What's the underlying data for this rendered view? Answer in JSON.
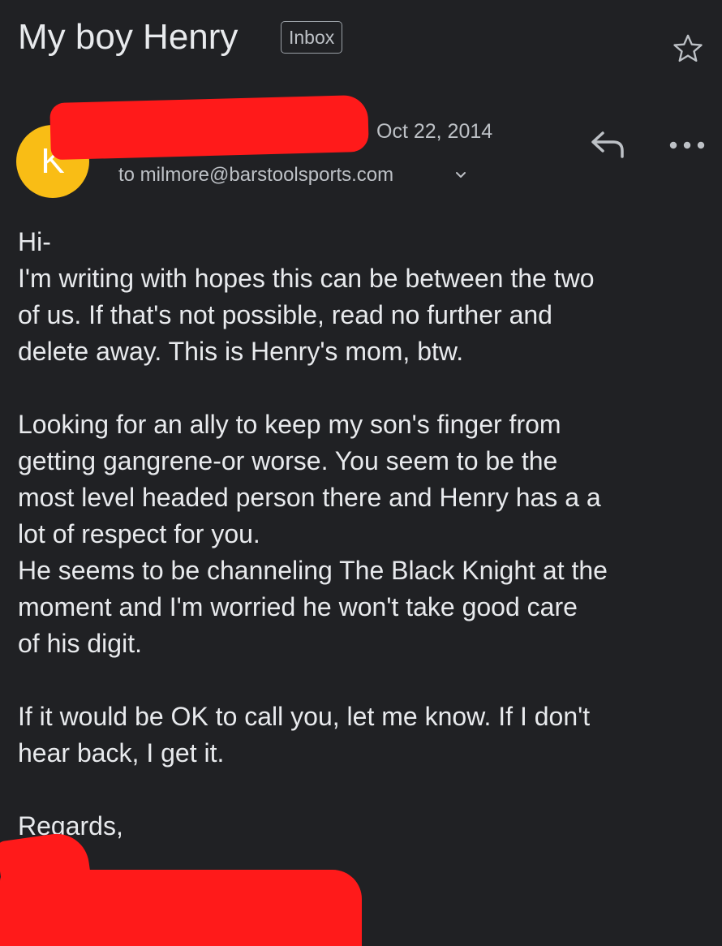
{
  "email": {
    "subject": "My boy Henry",
    "label": "Inbox",
    "sender_initial": "K",
    "date": "Oct 22, 2014",
    "recipient": "to milmore@barstoolsports.com",
    "body_lines": [
      "Hi-",
      "I'm writing with hopes this can be between the two",
      "of us. If that's not possible, read no further and",
      "delete away. This is Henry's mom, btw.",
      "",
      "Looking for an ally to keep my son's finger from",
      "getting gangrene-or worse. You seem to be the",
      "most level headed person there and Henry has a a",
      "lot of respect for you.",
      "He seems to be channeling The Black Knight at the",
      "moment and I'm worried he won't take good care",
      "of his digit.",
      "",
      "If it would be OK to call you, let me know. If I don't",
      "hear back, I get it.",
      "",
      "Regards,"
    ]
  },
  "icons": {
    "star": "star-outline-icon",
    "reply": "reply-icon",
    "more": "more-horizontal-icon",
    "chevron": "chevron-down-icon"
  },
  "colors": {
    "background": "#202124",
    "text": "#e8eaed",
    "muted": "#bdc1c6",
    "avatar": "#f9bd15",
    "redaction": "#ff1a1a"
  }
}
